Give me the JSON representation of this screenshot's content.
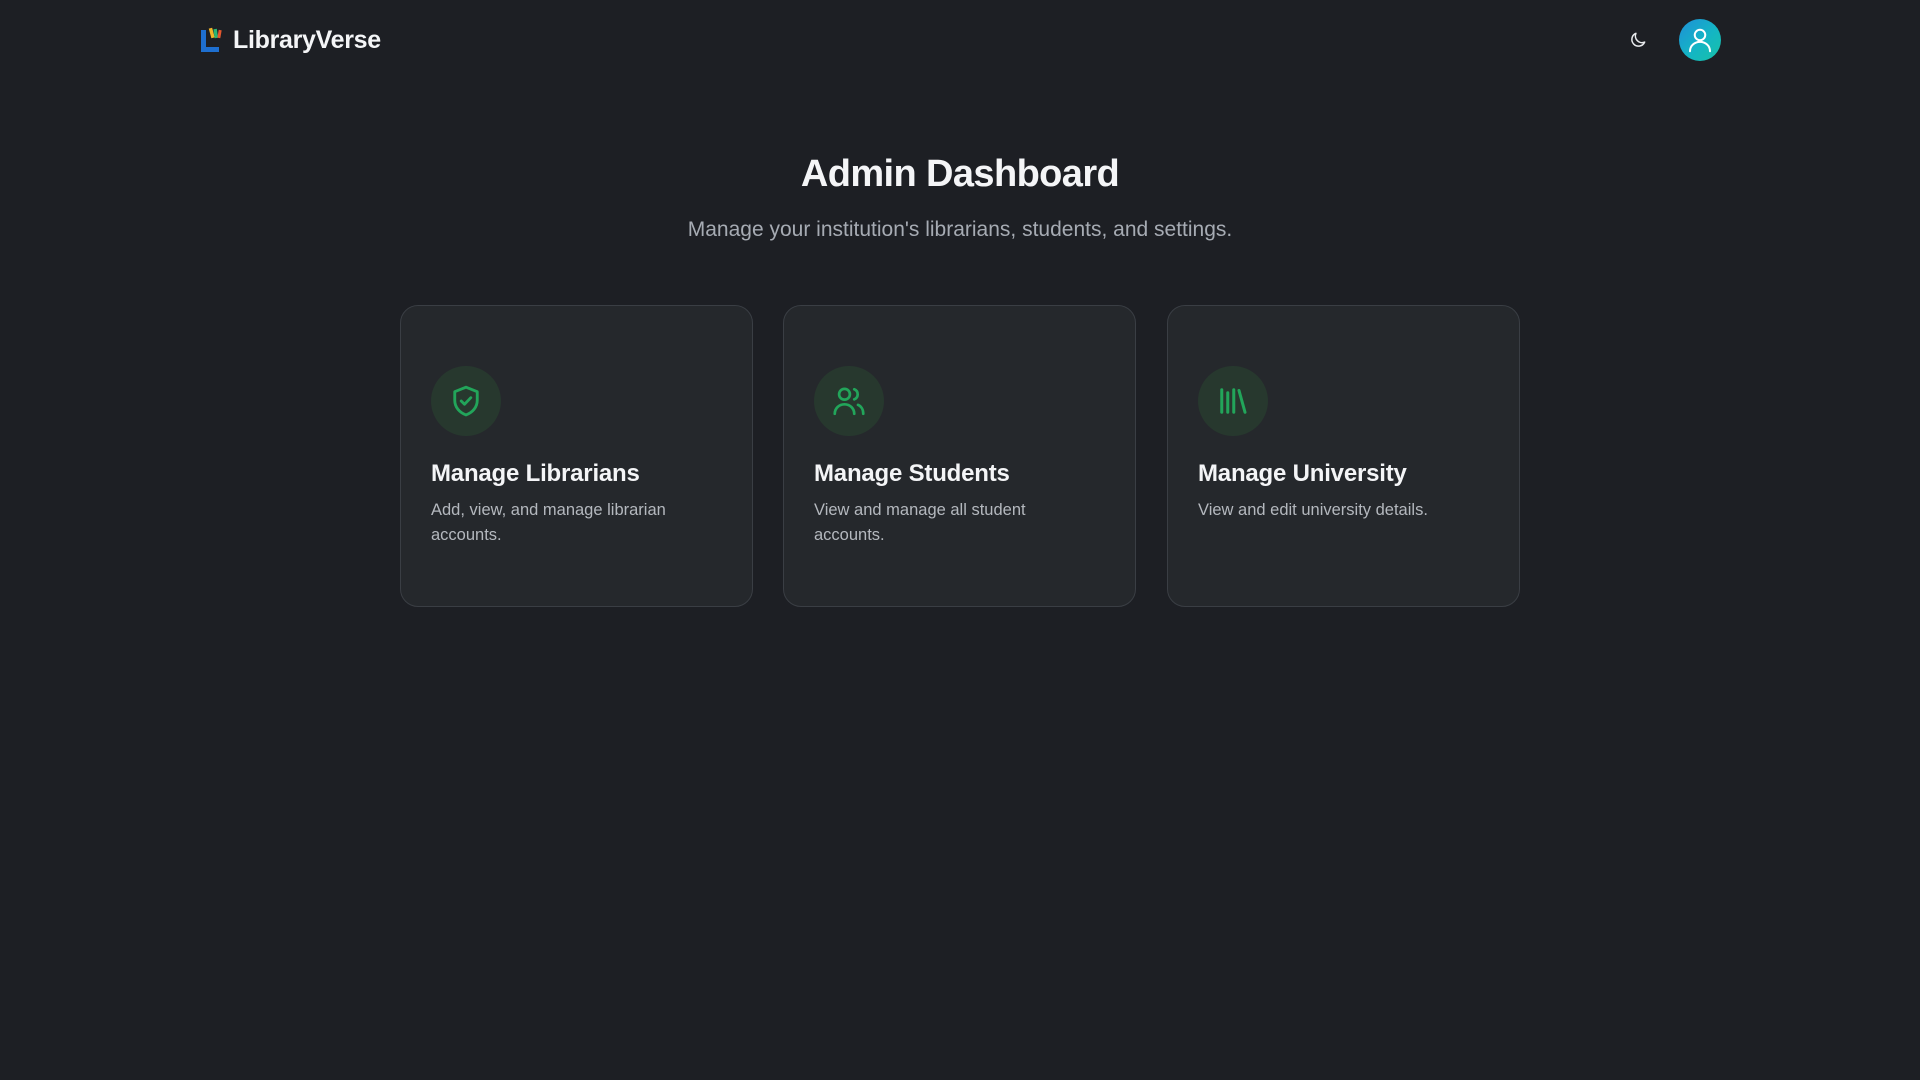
{
  "header": {
    "brand_name": "LibraryVerse",
    "logo_icon": "library-logo-icon",
    "theme_toggle_icon": "moon-icon",
    "avatar_icon": "user-icon"
  },
  "hero": {
    "title": "Admin Dashboard",
    "subtitle": "Manage your institution's librarians, students, and settings."
  },
  "cards": [
    {
      "title": "Manage Librarians",
      "description": "Add, view, and manage librarian accounts.",
      "icon": "shield-check-icon"
    },
    {
      "title": "Manage Students",
      "description": "View and manage all student accounts.",
      "icon": "users-icon"
    },
    {
      "title": "Manage University",
      "description": "View and edit university details.",
      "icon": "library-books-icon"
    }
  ],
  "colors": {
    "background": "#1d1f24",
    "card_background": "#25282c",
    "card_border": "#3a3e44",
    "accent_green": "#22a55a",
    "icon_circle": "#27382e",
    "avatar_gradient_start": "#1f8fd8",
    "avatar_gradient_end": "#18c2a6"
  }
}
